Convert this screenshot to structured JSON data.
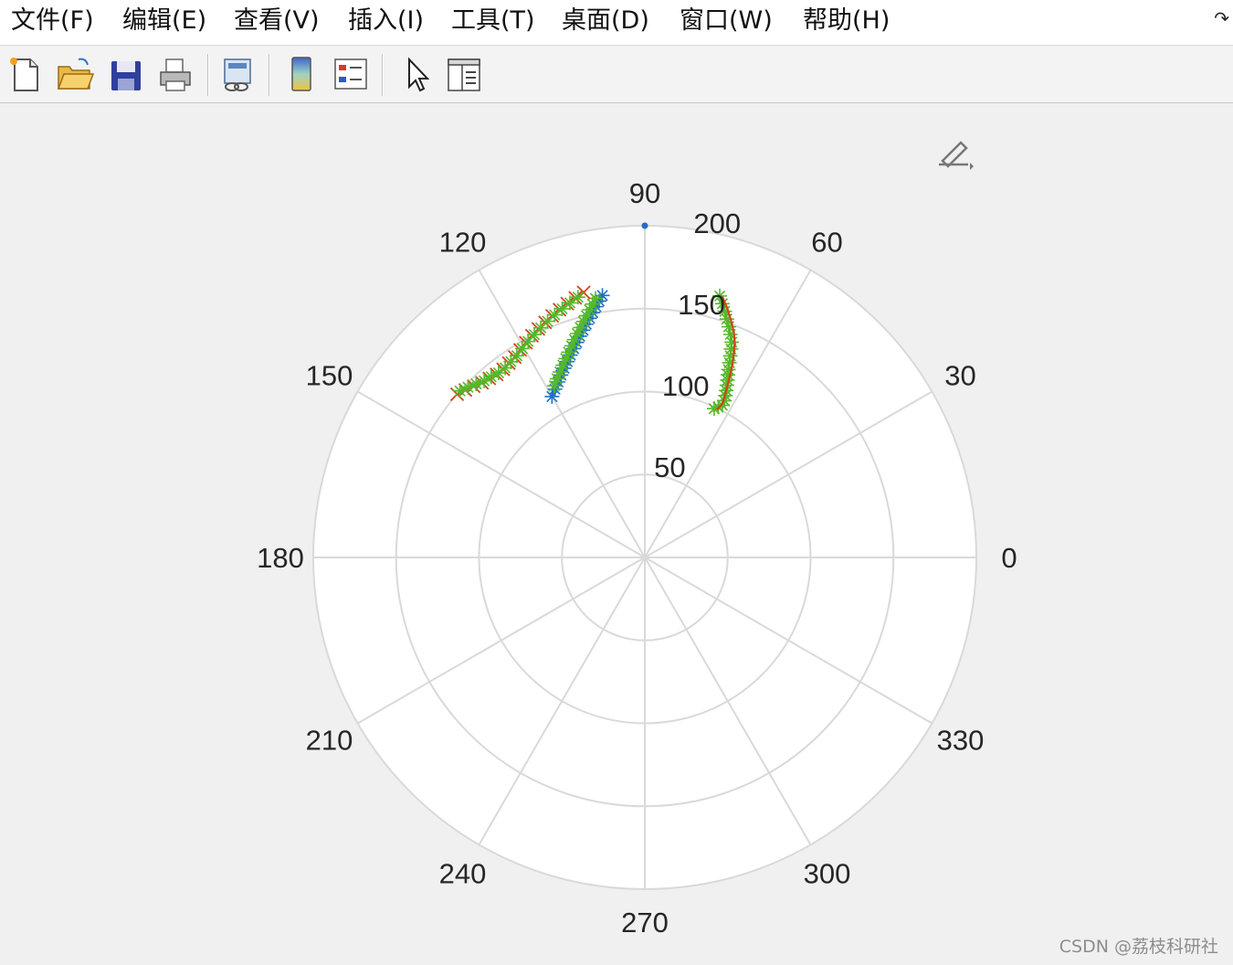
{
  "menubar": {
    "items": [
      {
        "label": "文件(F)"
      },
      {
        "label": "编辑(E)"
      },
      {
        "label": "查看(V)"
      },
      {
        "label": "插入(I)"
      },
      {
        "label": "工具(T)"
      },
      {
        "label": "桌面(D)"
      },
      {
        "label": "窗口(W)"
      },
      {
        "label": "帮助(H)"
      }
    ],
    "overflow_icon": "curved-arrow-icon"
  },
  "toolbar": {
    "buttons": [
      {
        "icon": "new-file-icon"
      },
      {
        "icon": "open-folder-icon"
      },
      {
        "icon": "save-disk-icon"
      },
      {
        "icon": "print-icon"
      },
      {
        "icon": "link-figure-icon"
      },
      {
        "icon": "colorbar-icon"
      },
      {
        "icon": "legend-icon"
      },
      {
        "icon": "pointer-arrow-icon"
      },
      {
        "icon": "property-inspector-icon"
      }
    ]
  },
  "figure": {
    "edit_plot_icon": "edit-plot-icon",
    "watermark": "CSDN @荔枝科研社"
  },
  "chart_data": {
    "type": "scatter",
    "coordinate_system": "polar",
    "theta_unit": "degrees",
    "rlim": [
      0,
      200
    ],
    "r_ticks": [
      "50",
      "100",
      "150",
      "200"
    ],
    "theta_ticks": [
      "0",
      "30",
      "60",
      "90",
      "120",
      "150",
      "180",
      "210",
      "240",
      "270",
      "300",
      "330"
    ],
    "grid": true,
    "colors": {
      "blue": "#1f6fc4",
      "red": "#d7401c",
      "green": "#55b82a",
      "grid": "#d9d9d9",
      "axis_bg": "#ffffff"
    },
    "series": [
      {
        "color": "#1f6fc4",
        "marker": "asterisk",
        "line": "solid",
        "r": [
          112,
          115,
          118,
          121,
          124,
          127,
          130,
          133,
          136,
          139,
          142,
          145,
          148,
          151,
          154,
          157,
          160
        ],
        "theta": [
          120.0,
          118.1,
          116.3,
          114.7,
          113.1,
          111.6,
          110.2,
          108.8,
          107.6,
          106.4,
          105.2,
          104.1,
          103.0,
          102.0,
          101.0,
          100.1,
          99.2
        ]
      },
      {
        "color": "#55b82a",
        "marker": "asterisk",
        "line": "solid",
        "r": [
          117,
          120,
          123,
          126,
          129,
          132,
          135,
          138,
          141,
          144,
          147,
          150,
          153,
          156,
          159
        ],
        "theta": [
          117.8,
          116.2,
          114.6,
          113.1,
          111.7,
          110.4,
          109.1,
          107.9,
          106.8,
          105.7,
          104.6,
          103.6,
          102.6,
          101.7,
          100.8
        ]
      },
      {
        "color": "#d7401c",
        "marker": "x",
        "line": "solid",
        "r": [
          150,
          148,
          146,
          144,
          143,
          142,
          142,
          143,
          144,
          146,
          148,
          150,
          152,
          154,
          156,
          158,
          160,
          162,
          164
        ],
        "theta": [
          139.0,
          137.0,
          135.0,
          133.0,
          131.0,
          129.0,
          127.0,
          125.0,
          123.0,
          121.0,
          119.0,
          117.0,
          115.0,
          113.0,
          111.0,
          109.0,
          107.0,
          105.0,
          103.0
        ]
      },
      {
        "color": "#55b82a",
        "marker": "asterisk",
        "line": "solid",
        "r": [
          150,
          148,
          146,
          144,
          143,
          142,
          142,
          143,
          144,
          146,
          148,
          150,
          152,
          154,
          156,
          158,
          160,
          162
        ],
        "theta": [
          138.0,
          136.1,
          134.2,
          132.3,
          130.4,
          128.4,
          126.4,
          124.4,
          122.4,
          120.4,
          118.4,
          116.4,
          114.4,
          112.4,
          110.4,
          108.4,
          106.4,
          104.4
        ]
      },
      {
        "color": "#55b82a",
        "marker": "asterisk",
        "line": "solid",
        "r": [
          99,
          101,
          103,
          106,
          109,
          112,
          115,
          118,
          121,
          124,
          128,
          132,
          136,
          140,
          144,
          148,
          152,
          156,
          160,
          164
        ],
        "theta": [
          65.0,
          64.0,
          63.0,
          63.0,
          63.5,
          64.0,
          64.5,
          65.0,
          65.5,
          66.0,
          66.5,
          67.0,
          67.5,
          68.0,
          69.0,
          70.0,
          71.0,
          72.0,
          73.0,
          74.0
        ]
      },
      {
        "color": "#d7401c",
        "marker": "none",
        "line": "solid",
        "r": [
          99,
          104,
          110,
          116,
          122,
          128,
          134,
          140,
          146,
          152,
          158,
          164
        ],
        "theta": [
          64.0,
          63.2,
          63.8,
          64.4,
          65.0,
          65.6,
          66.4,
          67.2,
          68.4,
          70.0,
          71.6,
          73.4
        ]
      },
      {
        "color": "#1f6fc4",
        "marker": "point",
        "line": "none",
        "r": [
          200
        ],
        "theta": [
          90.0
        ]
      }
    ]
  }
}
